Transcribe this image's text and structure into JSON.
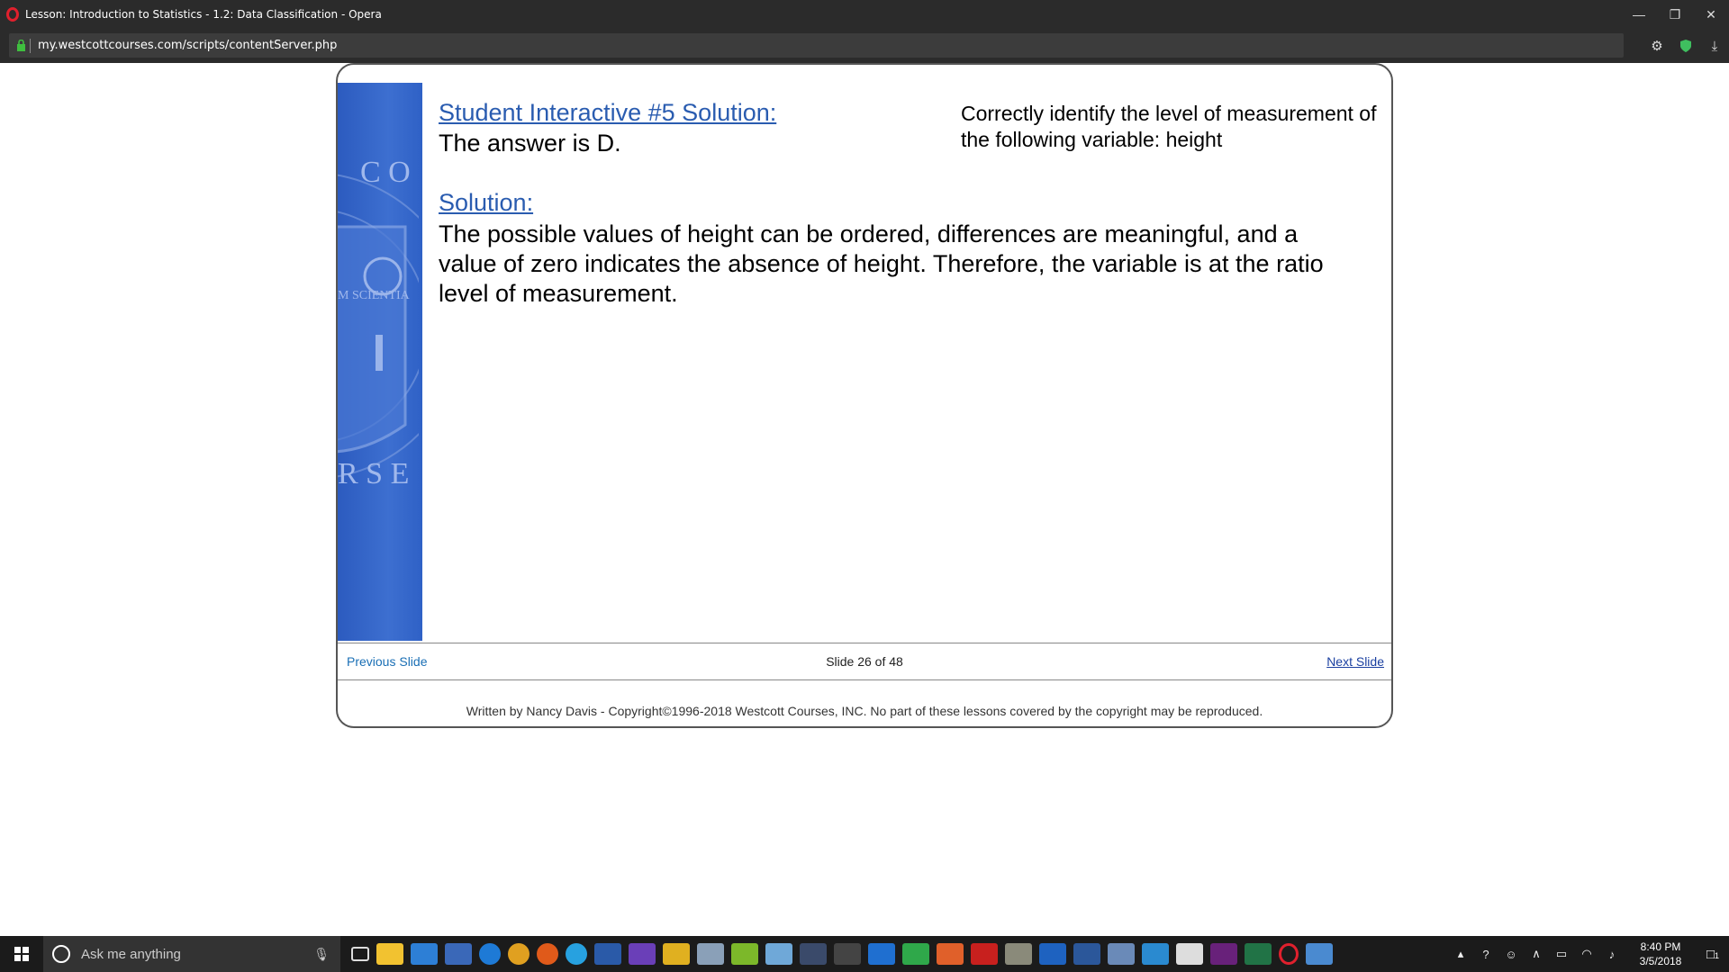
{
  "browser": {
    "window_title": "Lesson: Introduction to Statistics - 1.2: Data Classification - Opera",
    "url": "my.westcottcourses.com/scripts/contentServer.php"
  },
  "slide": {
    "heading": "Student Interactive #5 Solution:",
    "answer": "The answer is D.",
    "question": "Correctly identify the level of measurement of the following variable:  height",
    "solution_heading": "Solution:",
    "solution_text": "The possible values of height can be ordered, differences are meaningful, and a value of zero indicates the absence of height.  Therefore, the variable is at the ratio level of measurement.",
    "seal_text_top": "C O",
    "seal_text_mid": "M SCIENTIA",
    "seal_text_bottom": "R S E"
  },
  "nav": {
    "previous": "Previous Slide",
    "counter": "Slide 26 of 48",
    "next": "Next Slide"
  },
  "footer": {
    "copyright": "Written by Nancy Davis - Copyright©1996-2018 Westcott Courses, INC. No part of these lessons covered by the copyright may be reproduced."
  },
  "taskbar": {
    "search_placeholder": "Ask me anything",
    "time": "8:40 PM",
    "date": "3/5/2018",
    "notification_count": "1"
  }
}
